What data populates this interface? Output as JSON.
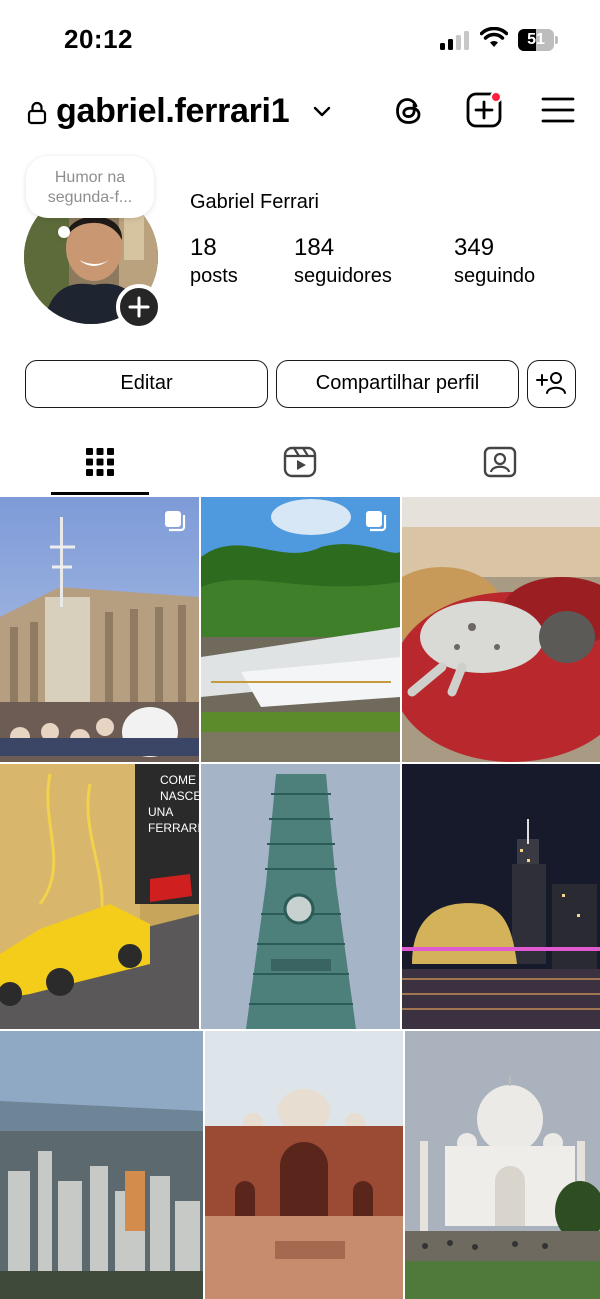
{
  "status_bar": {
    "time": "20:12",
    "battery": "51",
    "battery_level": 0.51
  },
  "header": {
    "username": "gabriel.ferrari1",
    "icons": [
      "lock-icon",
      "chevron-down-icon",
      "threads-icon",
      "new-post-icon",
      "menu-icon"
    ]
  },
  "profile": {
    "note": "Humor na segunda-f...",
    "full_name": "Gabriel Ferrari",
    "stats": [
      {
        "value": "18",
        "label": "posts"
      },
      {
        "value": "184",
        "label": "seguidores"
      },
      {
        "value": "349",
        "label": "seguindo"
      }
    ]
  },
  "actions": {
    "edit": "Editar",
    "share": "Compartilhar perfil"
  },
  "tabs": [
    "grid-icon",
    "reels-icon",
    "tagged-icon"
  ],
  "posts": [
    {
      "subject": "Acropolis under scaffolding",
      "multiple": true
    },
    {
      "subject": "Waterfall in forest",
      "multiple": true
    },
    {
      "subject": "Dog sleeping on red cushion",
      "multiple": false
    },
    {
      "subject": "Yellow Ferrari model",
      "multiple": false,
      "sign": "COME NASCE UNA FERRARI"
    },
    {
      "subject": "Skyscraper from below",
      "multiple": false
    },
    {
      "subject": "Harbor skyline at night",
      "multiple": false
    },
    {
      "subject": "City skyline from above",
      "multiple": false
    },
    {
      "subject": "Red sandstone mosque",
      "multiple": false
    },
    {
      "subject": "Taj Mahal",
      "multiple": false
    }
  ],
  "colors": {
    "accent_dot": "#ff1f3f",
    "text": "#000000",
    "muted": "#8e8e8e"
  }
}
